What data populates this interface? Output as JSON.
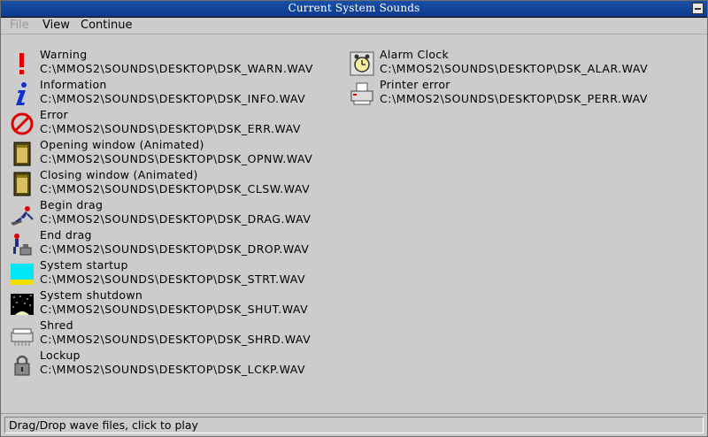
{
  "window": {
    "title": "Current System Sounds"
  },
  "menu": [
    {
      "label": "File",
      "disabled": true
    },
    {
      "label": "View",
      "disabled": false
    },
    {
      "label": "Continue",
      "disabled": false
    }
  ],
  "left_column": [
    {
      "icon": "warning-icon",
      "name": "Warning",
      "path": "C:\\MMOS2\\SOUNDS\\DESKTOP\\DSK_WARN.WAV"
    },
    {
      "icon": "information-icon",
      "name": "Information",
      "path": "C:\\MMOS2\\SOUNDS\\DESKTOP\\DSK_INFO.WAV"
    },
    {
      "icon": "error-icon",
      "name": "Error",
      "path": "C:\\MMOS2\\SOUNDS\\DESKTOP\\DSK_ERR.WAV"
    },
    {
      "icon": "opening-window-icon",
      "name": "Opening window (Animated)",
      "path": "C:\\MMOS2\\SOUNDS\\DESKTOP\\DSK_OPNW.WAV"
    },
    {
      "icon": "closing-window-icon",
      "name": "Closing window (Animated)",
      "path": "C:\\MMOS2\\SOUNDS\\DESKTOP\\DSK_CLSW.WAV"
    },
    {
      "icon": "begin-drag-icon",
      "name": "Begin drag",
      "path": "C:\\MMOS2\\SOUNDS\\DESKTOP\\DSK_DRAG.WAV"
    },
    {
      "icon": "end-drag-icon",
      "name": "End drag",
      "path": "C:\\MMOS2\\SOUNDS\\DESKTOP\\DSK_DROP.WAV"
    },
    {
      "icon": "system-startup-icon",
      "name": "System startup",
      "path": "C:\\MMOS2\\SOUNDS\\DESKTOP\\DSK_STRT.WAV"
    },
    {
      "icon": "system-shutdown-icon",
      "name": "System shutdown",
      "path": "C:\\MMOS2\\SOUNDS\\DESKTOP\\DSK_SHUT.WAV"
    },
    {
      "icon": "shredder-icon",
      "name": "Shred",
      "path": "C:\\MMOS2\\SOUNDS\\DESKTOP\\DSK_SHRD.WAV"
    },
    {
      "icon": "lock-icon",
      "name": "Lockup",
      "path": "C:\\MMOS2\\SOUNDS\\DESKTOP\\DSK_LCKP.WAV"
    }
  ],
  "right_column": [
    {
      "icon": "alarm-clock-icon",
      "name": "Alarm Clock",
      "path": "C:\\MMOS2\\SOUNDS\\DESKTOP\\DSK_ALAR.WAV"
    },
    {
      "icon": "printer-error-icon",
      "name": "Printer error",
      "path": "C:\\MMOS2\\SOUNDS\\DESKTOP\\DSK_PERR.WAV"
    }
  ],
  "status": {
    "text": "Drag/Drop wave files, click to play"
  }
}
